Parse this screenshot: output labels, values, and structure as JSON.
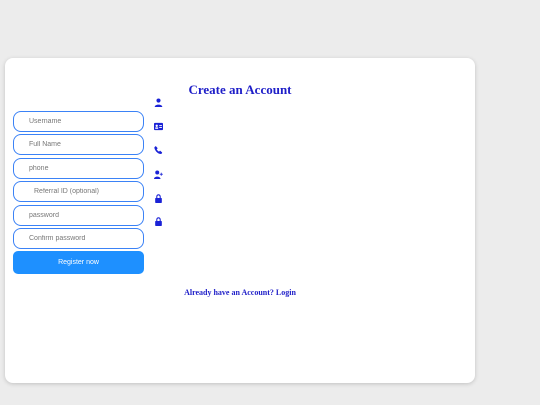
{
  "form": {
    "title": "Create an Account",
    "fields": [
      {
        "placeholder": "Username",
        "value": ""
      },
      {
        "placeholder": "Full Name",
        "value": ""
      },
      {
        "placeholder": "phone",
        "value": ""
      },
      {
        "placeholder": "Referral ID (optional)",
        "value": ""
      },
      {
        "placeholder": "password",
        "value": ""
      },
      {
        "placeholder": "Confirm password",
        "value": ""
      }
    ],
    "register_label": "Register now",
    "login_text": "Already have an Account? Login"
  },
  "icons": [
    "user-icon",
    "id-card-icon",
    "phone-icon",
    "user-plus-icon",
    "lock-icon",
    "lock-icon"
  ],
  "colors": {
    "accent": "#1e90ff",
    "title": "#1e1ec8",
    "border": "#3b82f6",
    "icon": "#1a22d6"
  }
}
